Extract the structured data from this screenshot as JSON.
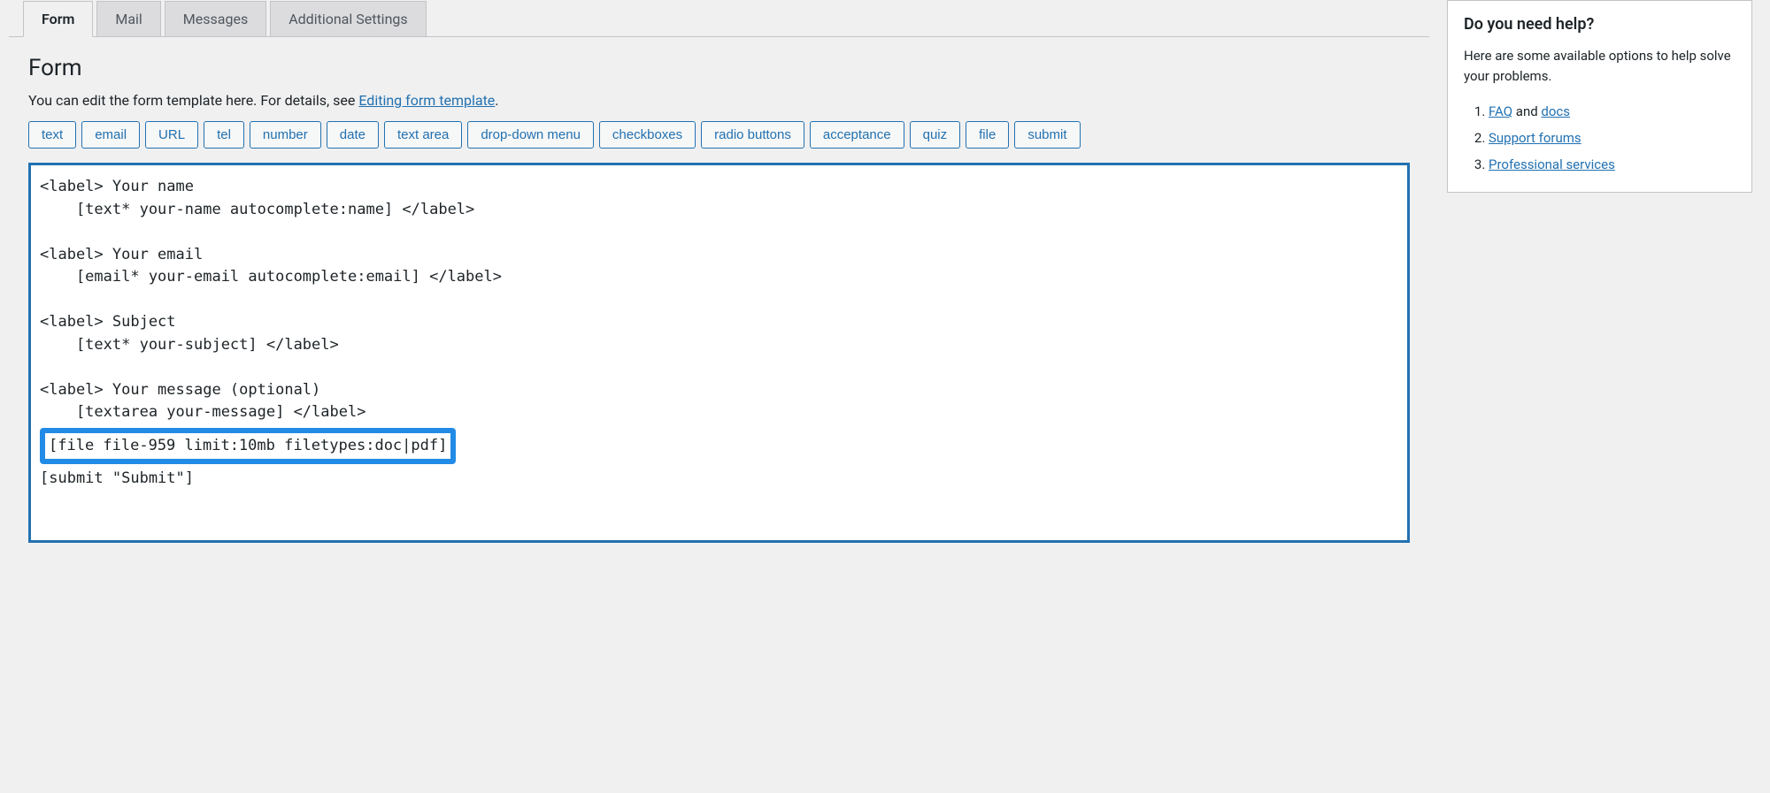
{
  "tabs": [
    {
      "label": "Form",
      "active": true
    },
    {
      "label": "Mail",
      "active": false
    },
    {
      "label": "Messages",
      "active": false
    },
    {
      "label": "Additional Settings",
      "active": false
    }
  ],
  "form": {
    "heading": "Form",
    "desc_prefix": "You can edit the form template here. For details, see ",
    "desc_link_text": "Editing form template",
    "desc_suffix": ".",
    "tag_buttons": [
      "text",
      "email",
      "URL",
      "tel",
      "number",
      "date",
      "text area",
      "drop-down menu",
      "checkboxes",
      "radio buttons",
      "acceptance",
      "quiz",
      "file",
      "submit"
    ],
    "code_before": "<label> Your name\n    [text* your-name autocomplete:name] </label>\n\n<label> Your email\n    [email* your-email autocomplete:email] </label>\n\n<label> Subject\n    [text* your-subject] </label>\n\n<label> Your message (optional)\n    [textarea your-message] </label>\n",
    "code_highlight": "[file file-959 limit:10mb filetypes:doc|pdf]",
    "code_after": "\n[submit \"Submit\"]"
  },
  "help": {
    "title": "Do you need help?",
    "desc": "Here are some available options to help solve your problems.",
    "items": [
      {
        "link1": "FAQ",
        "middle": " and ",
        "link2": "docs"
      },
      {
        "link1": "Support forums"
      },
      {
        "link1": "Professional services"
      }
    ]
  }
}
